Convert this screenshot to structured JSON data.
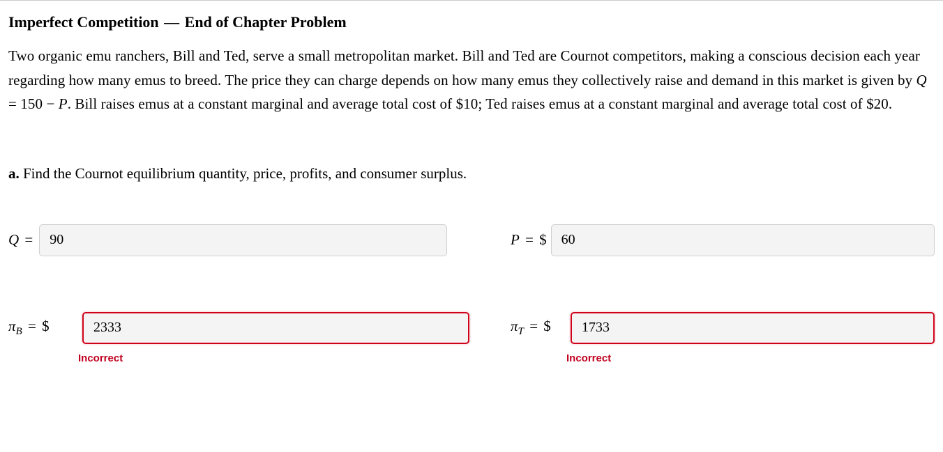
{
  "header": {
    "title_part1": "Imperfect Competition",
    "title_dash": "—",
    "title_part2": "End of Chapter Problem"
  },
  "problem": {
    "para_pre": "Two organic emu ranchers, Bill and Ted, serve a small metropolitan market. Bill and Ted are Cournot competitors, making a conscious decision each year regarding how many emus to breed. The price they can charge depends on how many emus they collectively raise and demand in this market is given by ",
    "equation_Q": "Q",
    "equation_mid": " = 150 − ",
    "equation_P": "P",
    "para_post": ". Bill raises emus at a constant marginal and average total cost of $10; Ted raises emus at a constant marginal and average total cost of $20."
  },
  "part_a": {
    "label_bold": "a.",
    "text": " Find the Cournot equilibrium quantity, price, profits, and consumer surplus."
  },
  "answers": {
    "Q": {
      "label_sym": "Q",
      "eq": " = ",
      "value": "90"
    },
    "P": {
      "label_sym": "P",
      "eq": " = ",
      "dollar": "$",
      "value": "60"
    },
    "piB": {
      "label_sym": "π",
      "sub": "B",
      "eq": " = ",
      "dollar": "$",
      "value": "2333",
      "feedback": "Incorrect"
    },
    "piT": {
      "label_sym": "π",
      "sub": "T",
      "eq": " = ",
      "dollar": "$",
      "value": "1733",
      "feedback": "Incorrect"
    }
  }
}
